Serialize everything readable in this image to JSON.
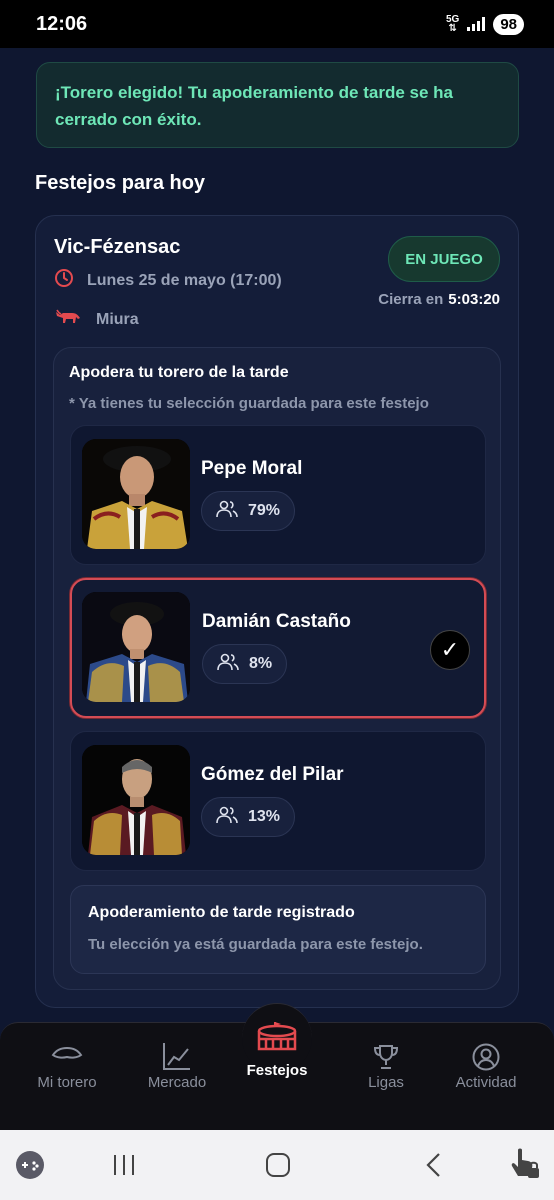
{
  "status_bar": {
    "time": "12:06",
    "network": "5G",
    "battery": "98"
  },
  "banner": {
    "text": "¡Torero elegido! Tu apoderamiento de tarde se ha cerrado con éxito."
  },
  "section_title": "Festejos para hoy",
  "event": {
    "name": "Vic-Fézensac",
    "date": "Lunes 25 de mayo (17:00)",
    "breed": "Miura",
    "status": "EN JUEGO",
    "closes_label": "Cierra en",
    "countdown": "5:03:20"
  },
  "pick": {
    "title": "Apodera tu torero de la tarde",
    "note": "* Ya tienes tu selección guardada para este festejo",
    "toreros": [
      {
        "name": "Pepe Moral",
        "percent": "79%"
      },
      {
        "name": "Damián Castaño",
        "percent": "8%",
        "check": "✓"
      },
      {
        "name": "Gómez del Pilar",
        "percent": "13%"
      }
    ],
    "registered_title": "Apoderamiento de tarde registrado",
    "registered_text": "Tu elección ya está guardada para este festejo."
  },
  "nav": {
    "items": [
      {
        "label": "Mi torero",
        "icon": "hat-icon"
      },
      {
        "label": "Mercado",
        "icon": "chart-icon"
      },
      {
        "label": "Festejos",
        "icon": "bullring-icon"
      },
      {
        "label": "Ligas",
        "icon": "trophy-icon"
      },
      {
        "label": "Actividad",
        "icon": "user-icon"
      }
    ],
    "active": "Festejos"
  },
  "colors": {
    "accent": "#6ee7b7",
    "selected_border": "#d44c55",
    "active_icon": "#e34a4f"
  }
}
